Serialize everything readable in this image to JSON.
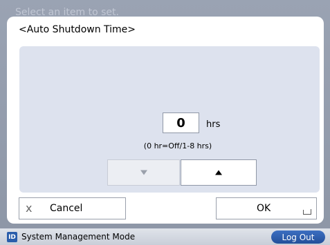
{
  "background_hint": "Select an item to set.",
  "dialog": {
    "title": "<Auto Shutdown Time>",
    "value": "0",
    "unit": "hrs",
    "range_hint": "(0 hr=Off/1-8 hrs)",
    "decrement_icon": "triangle-down-icon",
    "increment_icon": "triangle-up-icon",
    "cancel_label": "Cancel",
    "cancel_icon": "x",
    "ok_label": "OK"
  },
  "status_bar": {
    "badge": "ID",
    "mode": "System Management Mode",
    "logout_label": "Log Out"
  },
  "colors": {
    "accent": "#2a5dab",
    "panel": "#dde2ee"
  }
}
